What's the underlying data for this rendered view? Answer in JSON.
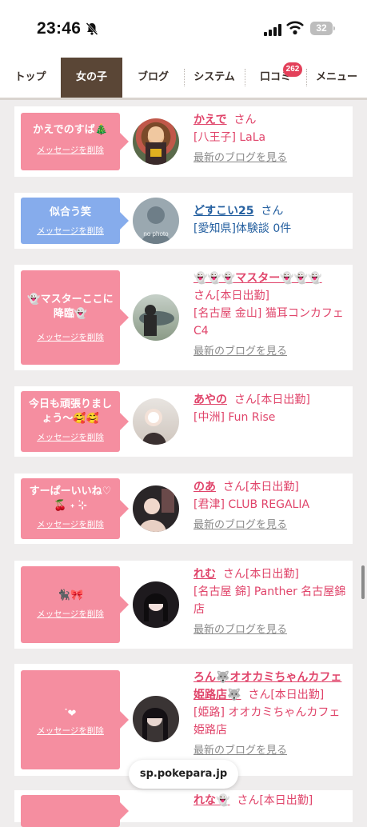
{
  "status_bar": {
    "time": "23:46",
    "battery": "32"
  },
  "nav": {
    "tabs": [
      {
        "label": "トップ"
      },
      {
        "label": "女の子"
      },
      {
        "label": "ブログ"
      },
      {
        "label": "システム"
      },
      {
        "label": "口コミ"
      },
      {
        "label": "メニュー"
      }
    ],
    "active_tab": "女の子",
    "kuchikomi_badge": "262"
  },
  "delete_label": "メッセージを削除",
  "blog_link_label": "最新のブログを見る",
  "cards": [
    {
      "message": "かえでのすば🎄",
      "name": "かえで",
      "san": "さん",
      "shop": "[八王子] LaLa"
    },
    {
      "message": "似合う笑",
      "name": "どすこい25",
      "san": "さん",
      "shop": "[愛知県]体験談 0件",
      "avatar_text": "no photo"
    },
    {
      "message": "👻マスターここに降臨👻",
      "name": "👻👻👻マスター👻👻👻",
      "san": "さん[本日出勤]",
      "shop": "[名古屋 金山] 猫耳コンカフェ C4"
    },
    {
      "message": "今日も頑張りましょう〜🥰🥰",
      "name": "あやの",
      "san": "さん[本日出勤]",
      "shop": "[中洲] Fun Rise"
    },
    {
      "message": "すーぱーいいね♡ 🍒 ˖ ࣪⊹",
      "name": "のあ",
      "san": "さん[本日出勤]",
      "shop": "[君津] CLUB REGALIA"
    },
    {
      "message": "🐈‍⬛🎀",
      "name": "れむ",
      "san": "さん[本日出勤]",
      "shop": "[名古屋 錦] Panther 名古屋錦店"
    },
    {
      "message": "ᐝ❤︎",
      "name": "ろん🐺オオカミちゃんカフェ姫路店🐺",
      "san": "さん[本日出勤]",
      "shop": "[姫路] オオカミちゃんカフェ姫路店"
    },
    {
      "name": "れな👻",
      "san": "さん[本日出勤]"
    }
  ],
  "url": "sp.pokepara.jp",
  "colors": {
    "accent_pink": "#e0446a",
    "message_pink": "#f58ea0",
    "message_blue": "#86acec",
    "active_tab": "#5a4636",
    "link_blue": "#2560a0"
  }
}
